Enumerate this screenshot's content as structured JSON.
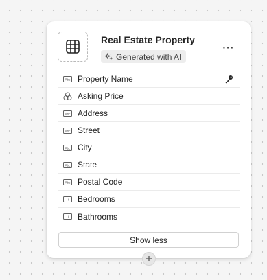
{
  "entity": {
    "title": "Real Estate Property",
    "badge_label": "Generated with AI",
    "more_label": "···"
  },
  "fields": [
    {
      "label": "Property Name",
      "type_icon": "text-field-icon",
      "is_key": true
    },
    {
      "label": "Asking Price",
      "type_icon": "currency-field-icon",
      "is_key": false
    },
    {
      "label": "Address",
      "type_icon": "text-field-icon",
      "is_key": false
    },
    {
      "label": "Street",
      "type_icon": "text-field-icon",
      "is_key": false
    },
    {
      "label": "City",
      "type_icon": "text-field-icon",
      "is_key": false
    },
    {
      "label": "State",
      "type_icon": "text-field-icon",
      "is_key": false
    },
    {
      "label": "Postal Code",
      "type_icon": "text-field-icon",
      "is_key": false
    },
    {
      "label": "Bedrooms",
      "type_icon": "number-field-icon",
      "is_key": false
    },
    {
      "label": "Bathrooms",
      "type_icon": "number-field-icon",
      "is_key": false
    }
  ],
  "actions": {
    "show_less_label": "Show less",
    "add_icon": "plus-icon"
  },
  "colors": {
    "canvas_background": "#f5f5f5",
    "canvas_dots": "#c8c8c8",
    "card_background": "#ffffff",
    "badge_background": "#ededed",
    "text_primary": "#242424",
    "row_divider": "#ebebeb"
  }
}
